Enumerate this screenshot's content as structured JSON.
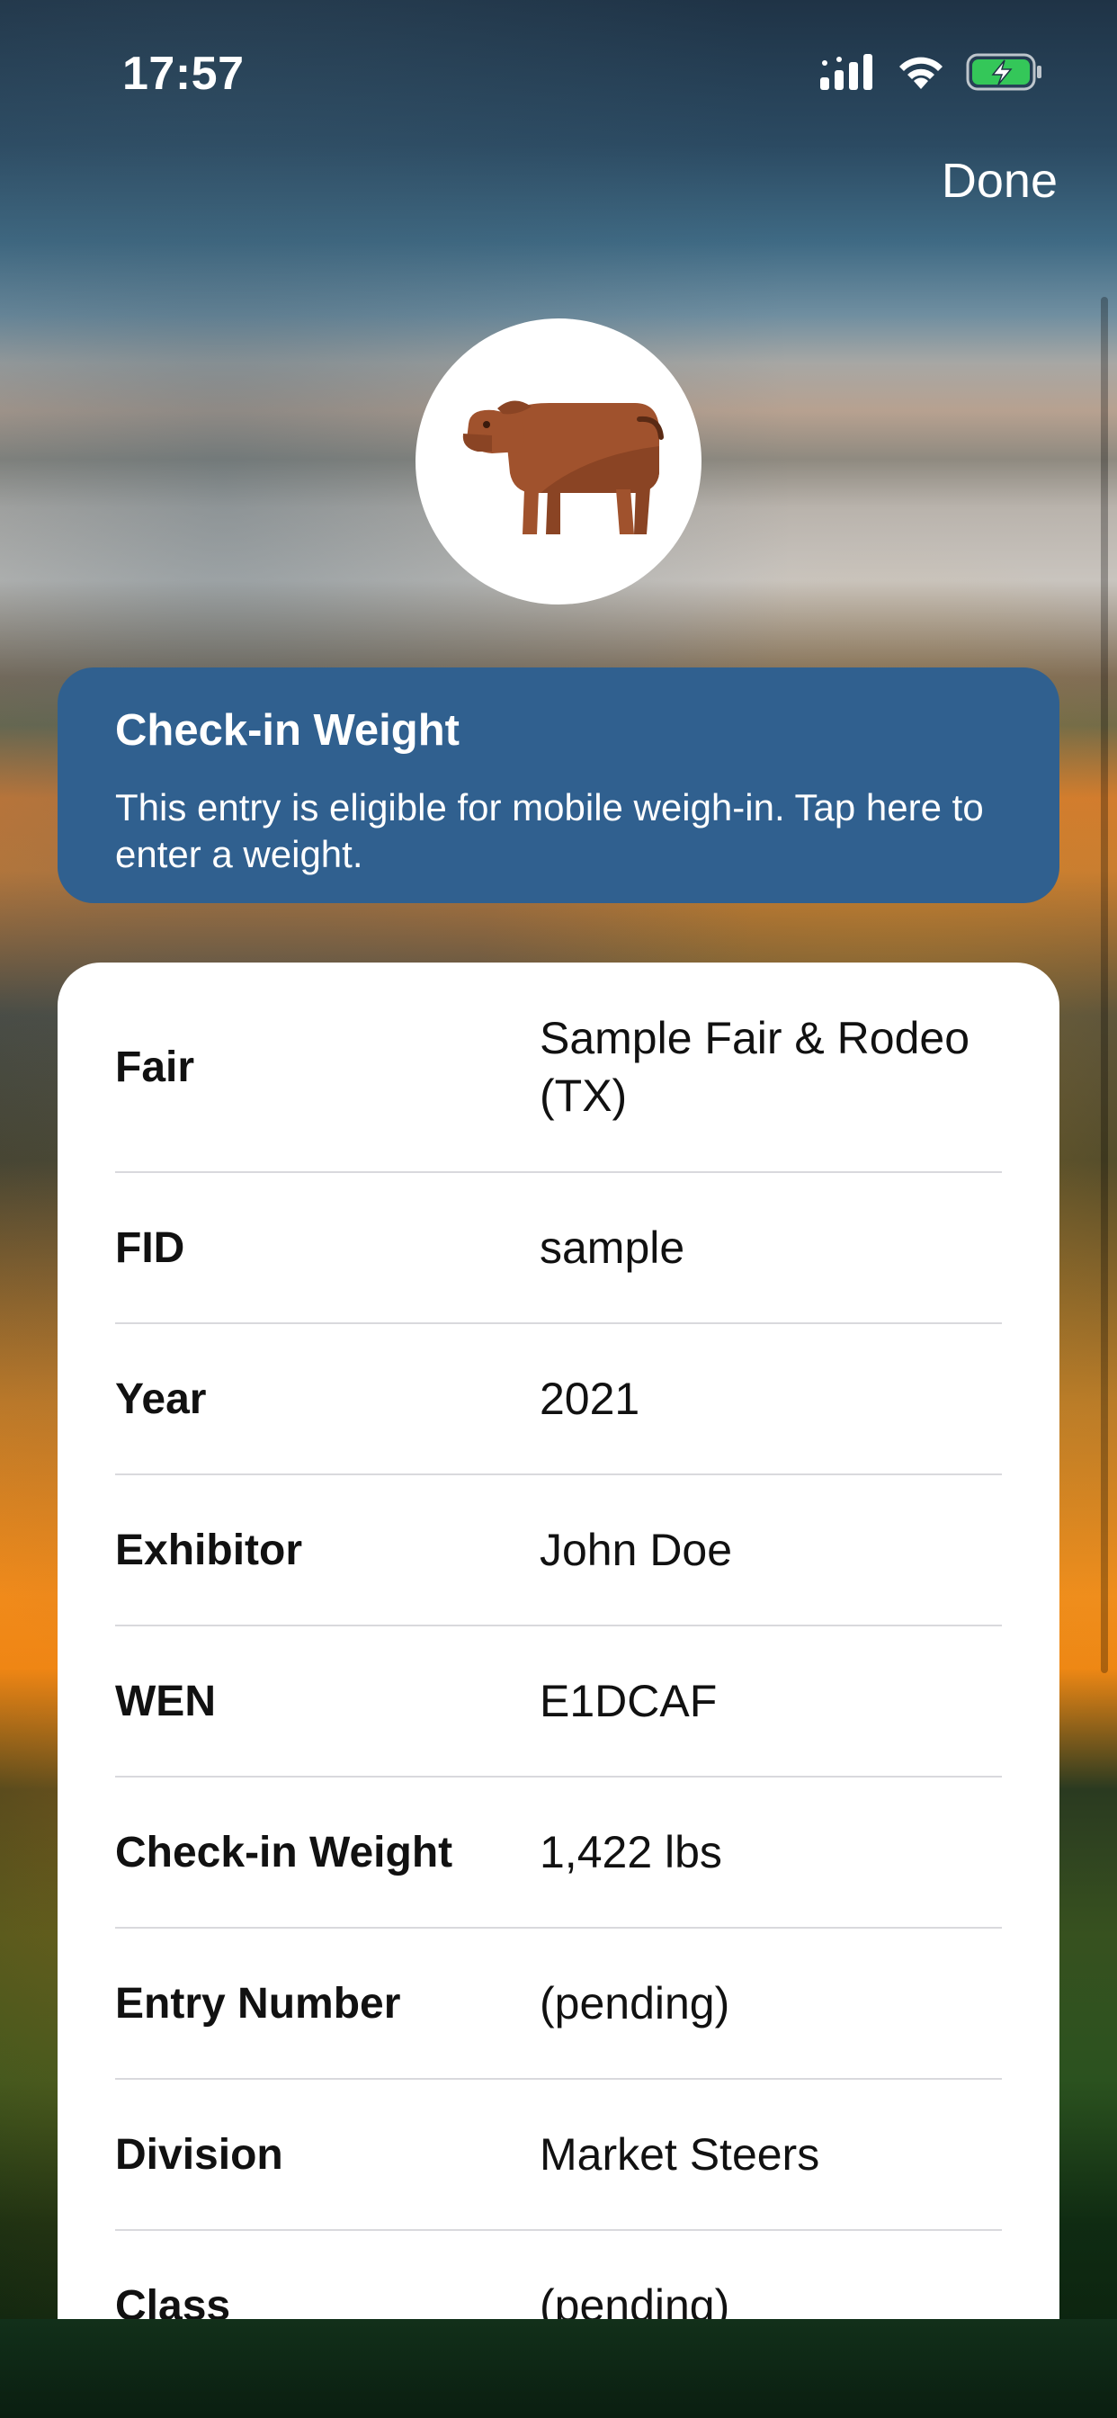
{
  "status_bar": {
    "time": "17:57"
  },
  "nav": {
    "done_label": "Done"
  },
  "banner": {
    "title": "Check-in Weight",
    "text": "This entry is eligible for mobile weigh-in. Tap here to enter a weight."
  },
  "details": {
    "rows": [
      {
        "label": "Fair",
        "value": "Sample Fair & Rodeo (TX)"
      },
      {
        "label": "FID",
        "value": "sample"
      },
      {
        "label": "Year",
        "value": "2021"
      },
      {
        "label": "Exhibitor",
        "value": "John Doe"
      },
      {
        "label": "WEN",
        "value": "E1DCAF"
      },
      {
        "label": "Check-in Weight",
        "value": "1,422 lbs"
      },
      {
        "label": "Entry Number",
        "value": "(pending)"
      },
      {
        "label": "Division",
        "value": "Market Steers"
      },
      {
        "label": "Class",
        "value": "(pending)"
      }
    ]
  },
  "colors": {
    "banner_bg": "#30608f",
    "card_bg": "#ffffff",
    "battery_fill": "#34c759",
    "cow_brown": "#a0522d"
  },
  "icons": [
    "cellular-signal-icon",
    "wifi-icon",
    "battery-charging-icon",
    "cow-icon"
  ]
}
